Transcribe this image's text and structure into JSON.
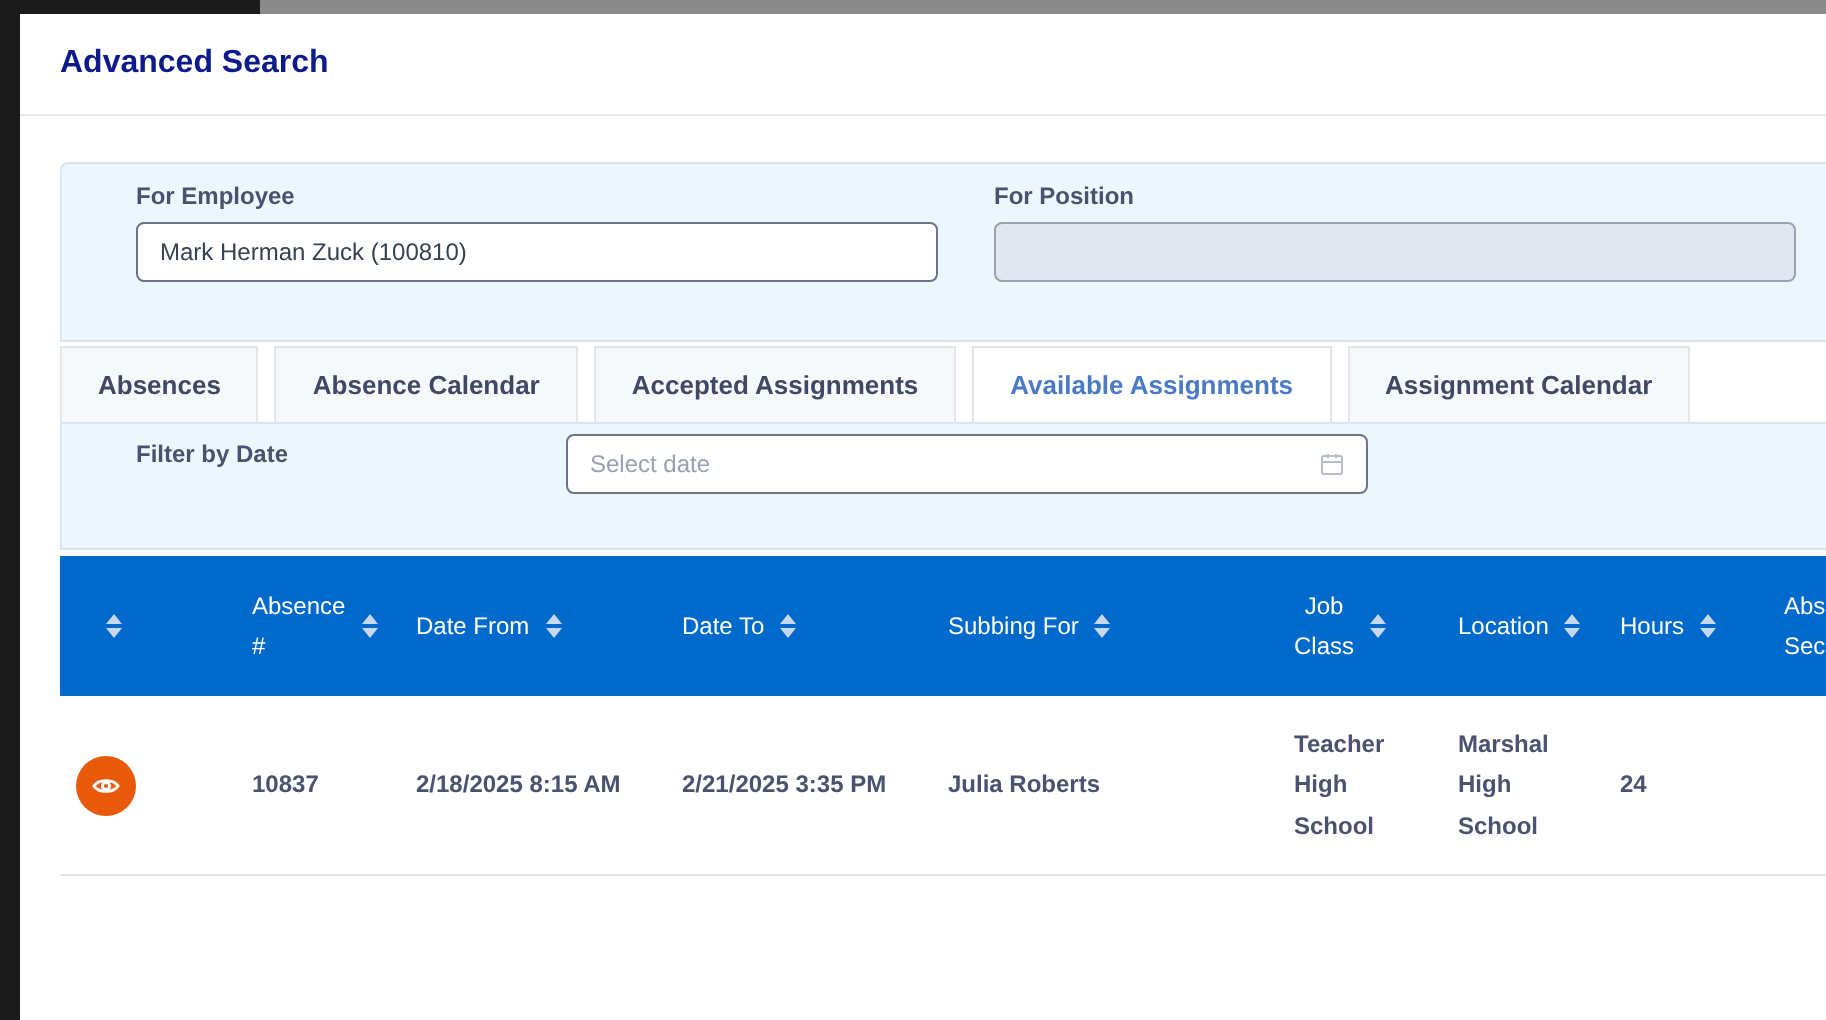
{
  "dialog": {
    "title": "Advanced Search"
  },
  "filters": [
    {
      "label": "For Employee",
      "value": "Mark Herman Zuck (100810)",
      "disabled": false
    },
    {
      "label": "For Position",
      "disabled": true
    }
  ],
  "tabs": [
    {
      "label": "Absences",
      "selected": false
    },
    {
      "label": "Absence Calendar",
      "selected": false
    },
    {
      "label": "Accepted Assignments",
      "selected": false
    },
    {
      "label": "Available Assignments",
      "selected": true
    },
    {
      "label": "Assignment Calendar",
      "selected": false
    }
  ],
  "date_filter": {
    "label": "Filter by Date",
    "placeholder": "Select date"
  },
  "table": {
    "columns": [
      {
        "lines": [
          "Absence",
          "#"
        ]
      },
      {
        "lines": [
          "Date From"
        ]
      },
      {
        "lines": [
          "Date To"
        ]
      },
      {
        "lines": [
          "Subbing For"
        ]
      },
      {
        "lines": [
          "Job",
          "Class"
        ]
      },
      {
        "lines": [
          "Location"
        ]
      },
      {
        "lines": [
          "Hours"
        ]
      },
      {
        "lines": [
          "Abs",
          "Sec"
        ]
      }
    ],
    "rows": [
      {
        "cells": [
          [
            "10837"
          ],
          [
            "2/18/2025 8:15 AM"
          ],
          [
            "2/21/2025 3:35 PM"
          ],
          [
            "Julia Roberts"
          ],
          [
            "Teacher",
            "High",
            "School"
          ],
          [
            "Marshal",
            "High",
            "School"
          ],
          [
            "24"
          ]
        ]
      }
    ]
  }
}
